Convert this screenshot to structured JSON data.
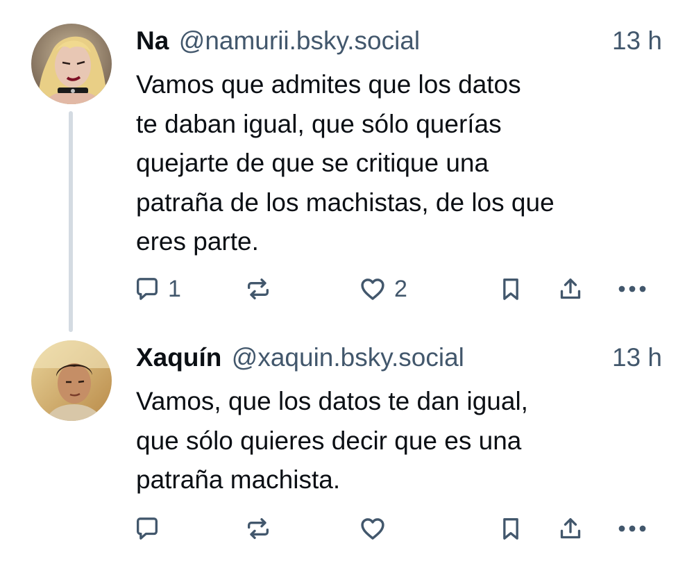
{
  "thread": {
    "posts": [
      {
        "display_name": "Na",
        "handle": "@namurii.bsky.social",
        "time": "13 h",
        "text": "Vamos que admites que los datos\nte daban igual, que sólo querías\nquejarte de que se critique una\npatraña de los machistas, de los que\neres parte.",
        "reply_count": "1",
        "repost_count": "",
        "like_count": "2"
      },
      {
        "display_name": "Xaquín",
        "handle": "@xaquin.bsky.social",
        "time": "13 h",
        "text": "Vamos, que los datos te dan igual,\nque sólo quieres decir que es una\npatraña machista.",
        "reply_count": "",
        "repost_count": "",
        "like_count": ""
      }
    ]
  },
  "icons": {
    "reply": "speech-bubble-icon",
    "repost": "repost-arrows-icon",
    "like": "heart-icon",
    "bookmark": "bookmark-icon",
    "share": "share-upload-icon",
    "more": "more-dots-icon"
  },
  "colors": {
    "text": "#0b0f14",
    "muted": "#42576c",
    "icon": "#42576c",
    "thread_line": "#d4dbe2"
  }
}
